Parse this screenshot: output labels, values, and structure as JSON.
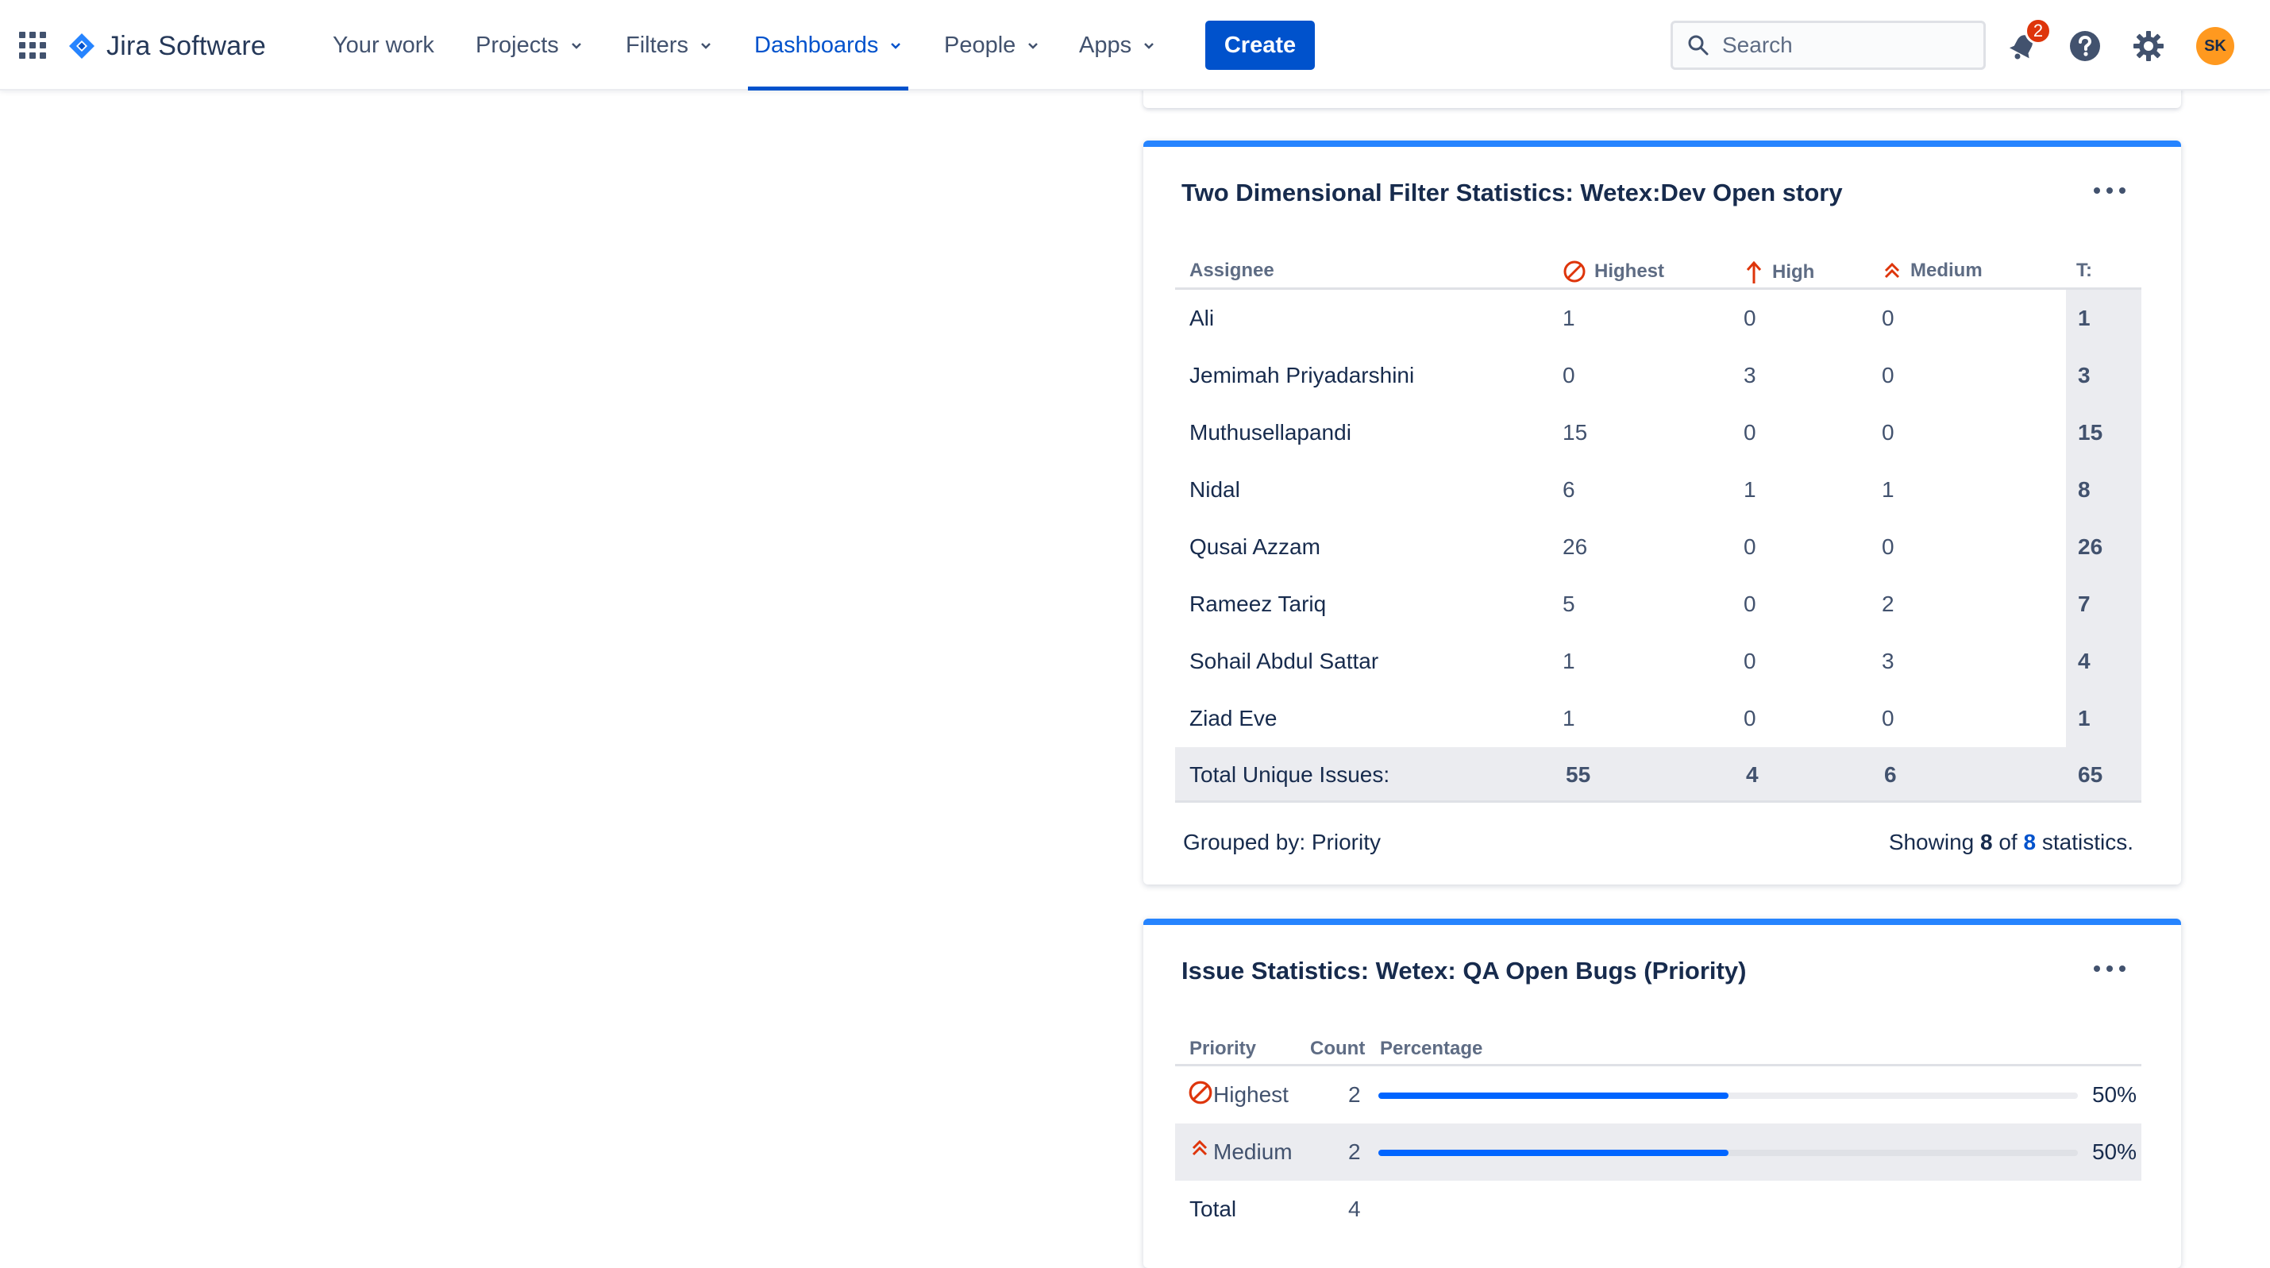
{
  "nav": {
    "product": "Jira Software",
    "items": [
      {
        "label": "Your work"
      },
      {
        "label": "Projects"
      },
      {
        "label": "Filters"
      },
      {
        "label": "Dashboards"
      },
      {
        "label": "People"
      },
      {
        "label": "Apps"
      }
    ],
    "active": "Dashboards",
    "create_label": "Create",
    "search_placeholder": "Search",
    "notification_count": "2",
    "avatar_initials": "SK",
    "icons": [
      "app-switcher-icon",
      "jira-logo-icon",
      "search-icon",
      "notification-icon",
      "help-icon",
      "settings-icon"
    ]
  },
  "two_dim": {
    "title": "Two Dimensional Filter Statistics: Wetex:Dev Open story",
    "headers": {
      "assignee": "Assignee",
      "highest": "Highest",
      "high": "High",
      "medium": "Medium",
      "total": "T:"
    },
    "rows": [
      {
        "name": "Ali",
        "highest": "1",
        "high": "0",
        "medium": "0",
        "total": "1"
      },
      {
        "name": "Jemimah Priyadarshini",
        "highest": "0",
        "high": "3",
        "medium": "0",
        "total": "3"
      },
      {
        "name": "Muthusellapandi",
        "highest": "15",
        "high": "0",
        "medium": "0",
        "total": "15"
      },
      {
        "name": "Nidal",
        "highest": "6",
        "high": "1",
        "medium": "1",
        "total": "8"
      },
      {
        "name": "Qusai Azzam",
        "highest": "26",
        "high": "0",
        "medium": "0",
        "total": "26"
      },
      {
        "name": "Rameez Tariq",
        "highest": "5",
        "high": "0",
        "medium": "2",
        "total": "7"
      },
      {
        "name": "Sohail Abdul Sattar",
        "highest": "1",
        "high": "0",
        "medium": "3",
        "total": "4"
      },
      {
        "name": "Ziad Eve",
        "highest": "1",
        "high": "0",
        "medium": "0",
        "total": "1"
      }
    ],
    "total_row": {
      "label": "Total Unique Issues:",
      "highest": "55",
      "high": "4",
      "medium": "6",
      "total": "65"
    },
    "grouped_by": "Grouped by: Priority",
    "showing_prefix": "Showing",
    "showing_count": "8",
    "showing_of": "of",
    "showing_total": "8",
    "showing_suffix": "statistics."
  },
  "issue_stats": {
    "title": "Issue Statistics: Wetex: QA Open Bugs (Priority)",
    "headers": {
      "priority": "Priority",
      "count": "Count",
      "percentage": "Percentage"
    },
    "rows": [
      {
        "priority": "Highest",
        "count": "2",
        "percent": "50%",
        "fraction": 0.5
      },
      {
        "priority": "Medium",
        "count": "2",
        "percent": "50%",
        "fraction": 0.5
      }
    ],
    "total_label": "Total",
    "total_count": "4"
  },
  "colors": {
    "brand": "#0052cc",
    "gadget_accent": "#2684ff",
    "priority_red": "#de350b",
    "bar": "#0065ff"
  }
}
